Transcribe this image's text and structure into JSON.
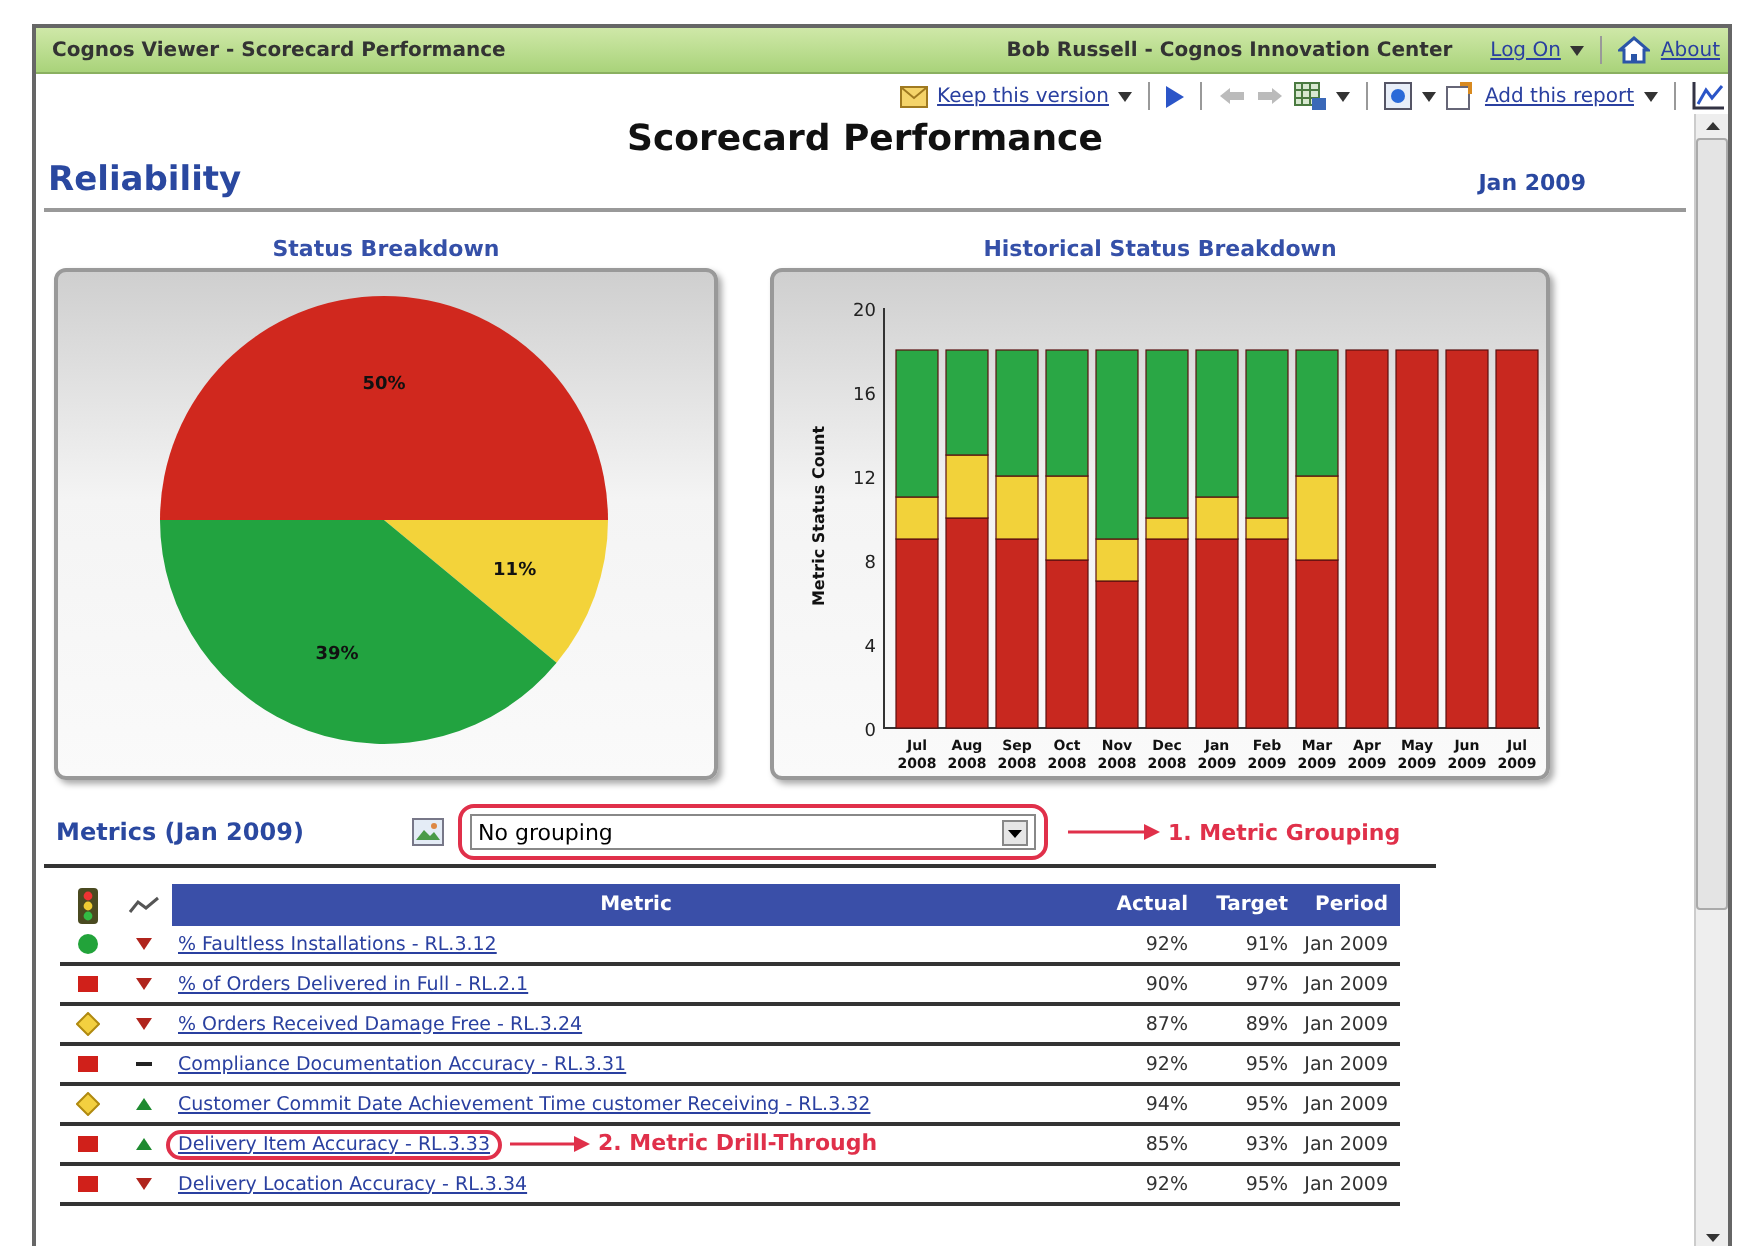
{
  "window": {
    "title": "Cognos Viewer - Scorecard Performance",
    "user": "Bob Russell - Cognos Innovation Center",
    "log_on": "Log On",
    "about": "About"
  },
  "toolbar": {
    "keep_version": "Keep this version",
    "add_report": "Add this report"
  },
  "report": {
    "title": "Scorecard Performance",
    "section": "Reliability",
    "period": "Jan 2009"
  },
  "status_chart": {
    "title": "Status Breakdown",
    "chart_data": {
      "type": "pie",
      "values": [
        50,
        11,
        39
      ],
      "value_labels": [
        "50%",
        "11%",
        "39%"
      ]
    }
  },
  "history_chart": {
    "title": "Historical Status Breakdown",
    "chart_data": {
      "type": "bar",
      "stacked": true,
      "ylabel": "Metric Status Count",
      "categories": [
        "Jul 2008",
        "Aug 2008",
        "Sep 2008",
        "Oct 2008",
        "Nov 2008",
        "Dec 2008",
        "Jan 2009",
        "Feb 2009",
        "Mar 2009",
        "Apr 2009",
        "May 2009",
        "Jun 2009",
        "Jul 2009"
      ],
      "ylim": [
        0,
        20
      ],
      "yticks": [
        0,
        4,
        8,
        12,
        16,
        20
      ],
      "series": [
        {
          "color": "#c8281f",
          "values": [
            9,
            10,
            9,
            8,
            7,
            9,
            9,
            9,
            8,
            18,
            18,
            18,
            18
          ]
        },
        {
          "color": "#f2d23a",
          "values": [
            2,
            3,
            3,
            4,
            2,
            1,
            2,
            1,
            4,
            0,
            0,
            0,
            0
          ]
        },
        {
          "color": "#2aa745",
          "values": [
            7,
            5,
            6,
            6,
            9,
            8,
            7,
            8,
            6,
            0,
            0,
            0,
            0
          ]
        }
      ]
    }
  },
  "grouping": {
    "label": "Metrics (Jan 2009)",
    "value": "No grouping",
    "annotation": "1. Metric Grouping"
  },
  "table": {
    "columns": [
      "Metric",
      "Actual",
      "Target",
      "Period"
    ],
    "rows": [
      {
        "status": {
          "kind": "circle",
          "color": "#22a33a"
        },
        "trend": {
          "kind": "down"
        },
        "metric": "% Faultless Installations - RL.3.12",
        "actual": "92%",
        "target": "91%",
        "period": "Jan 2009"
      },
      {
        "status": {
          "kind": "square",
          "color": "#d0201a"
        },
        "trend": {
          "kind": "down"
        },
        "metric": "% of Orders Delivered in Full - RL.2.1",
        "actual": "90%",
        "target": "97%",
        "period": "Jan 2009"
      },
      {
        "status": {
          "kind": "diamond",
          "color": "#f3d040"
        },
        "trend": {
          "kind": "down"
        },
        "metric": "% Orders Received Damage Free - RL.3.24",
        "actual": "87%",
        "target": "89%",
        "period": "Jan 2009"
      },
      {
        "status": {
          "kind": "square",
          "color": "#d0201a"
        },
        "trend": {
          "kind": "flat"
        },
        "metric": "Compliance Documentation Accuracy - RL.3.31",
        "actual": "92%",
        "target": "95%",
        "period": "Jan 2009"
      },
      {
        "status": {
          "kind": "diamond",
          "color": "#f3d040"
        },
        "trend": {
          "kind": "up"
        },
        "metric": "Customer Commit Date Achievement Time customer Receiving - RL.3.32",
        "actual": "94%",
        "target": "95%",
        "period": "Jan 2009"
      },
      {
        "status": {
          "kind": "square",
          "color": "#d0201a"
        },
        "trend": {
          "kind": "up"
        },
        "metric": "Delivery Item Accuracy - RL.3.33",
        "actual": "85%",
        "target": "93%",
        "period": "Jan 2009",
        "annotation": "2. Metric Drill-Through"
      },
      {
        "status": {
          "kind": "square",
          "color": "#d0201a"
        },
        "trend": {
          "kind": "down"
        },
        "metric": "Delivery Location Accuracy - RL.3.34",
        "actual": "92%",
        "target": "95%",
        "period": "Jan 2009"
      }
    ]
  }
}
